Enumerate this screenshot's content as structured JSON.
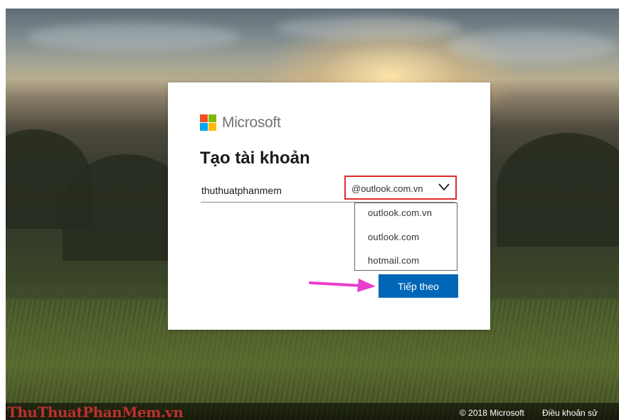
{
  "brand": {
    "name": "Microsoft"
  },
  "form": {
    "title": "Tạo tài khoản",
    "username_value": "thuthuatphanmem",
    "domain_selected": "@outlook.com.vn",
    "domain_options": [
      "outlook.com.vn",
      "outlook.com",
      "hotmail.com"
    ],
    "next_label": "Tiếp theo"
  },
  "footer": {
    "copyright": "© 2018 Microsoft",
    "terms": "Điều khoản sử dụng",
    "watermark": "ThuThuatPhanMem.vn"
  },
  "icons": {
    "logo": "microsoft-logo-icon",
    "chevron": "chevron-down-icon",
    "annotation_arrow": "arrow-right-icon"
  },
  "colors": {
    "accent": "#0067b8",
    "highlight_border": "#e02b2b",
    "annotation_arrow": "#e83ecf",
    "logo_red": "#f25022",
    "logo_green": "#7fba00",
    "logo_blue": "#00a4ef",
    "logo_yellow": "#ffb900"
  }
}
